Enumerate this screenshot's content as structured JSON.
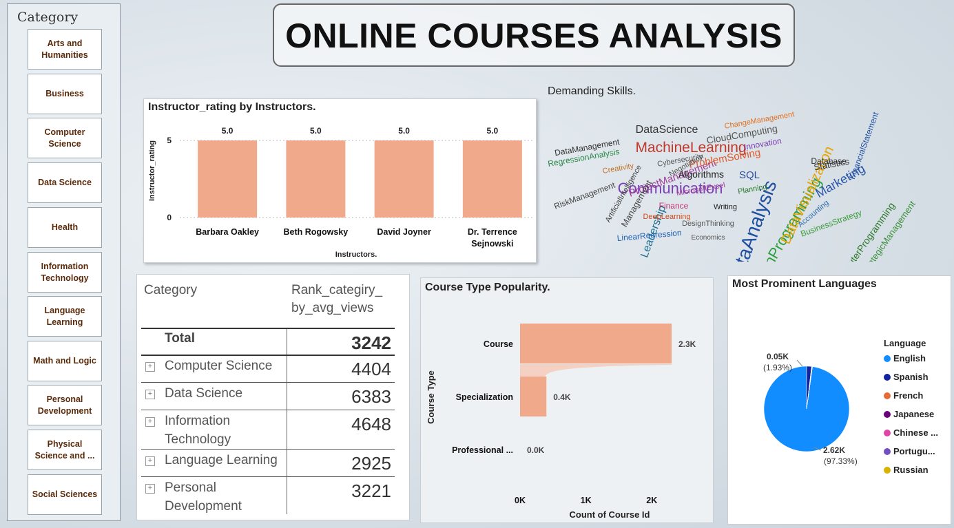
{
  "title": "ONLINE COURSES ANALYSIS",
  "slicer": {
    "title": "Category",
    "items": [
      "Arts and Humanities",
      "Business",
      "Computer Science",
      "Data Science",
      "Health",
      "Information Technology",
      "Language Learning",
      "Math and Logic",
      "Personal Development",
      "Physical Science and ...",
      "Social Sciences"
    ]
  },
  "instructor_chart": {
    "title": "Instructor_rating by Instructors.",
    "ylabel": "Instructor_rating",
    "xlabel": "Instructors.",
    "ticks": [
      "5",
      "0"
    ]
  },
  "wordcloud": {
    "title": "Demanding Skills.",
    "words": [
      {
        "text": "DataAnalysis",
        "color": "#1f4fa0"
      },
      {
        "text": "PythonProgramming",
        "color": "#2e9e3e"
      },
      {
        "text": "MachineLearning",
        "color": "#c0392b"
      },
      {
        "text": "Communication",
        "color": "#7b3fb5"
      },
      {
        "text": "DataScience",
        "color": "#333333"
      },
      {
        "text": "DataVisualization",
        "color": "#e6a300"
      },
      {
        "text": "Leadership",
        "color": "#1b6d8f"
      },
      {
        "text": "ProjectManagement",
        "color": "#a0409a"
      },
      {
        "text": "ProblemSolving",
        "color": "#e05a2a"
      },
      {
        "text": "Management",
        "color": "#444444"
      },
      {
        "text": "ComputerProgramming",
        "color": "#2a7a2a"
      },
      {
        "text": "Marketing",
        "color": "#2955a8"
      },
      {
        "text": "StrategicManagement",
        "color": "#3a8f3a"
      },
      {
        "text": "CloudComputing",
        "color": "#555555"
      },
      {
        "text": "Algorithms",
        "color": "#222222"
      },
      {
        "text": "SQL",
        "color": "#2a4f9a"
      },
      {
        "text": "RiskManagement",
        "color": "#444444"
      },
      {
        "text": "Finance",
        "color": "#c03070"
      },
      {
        "text": "DeepLearning",
        "color": "#d04a1a"
      },
      {
        "text": "RegressionAnalysis",
        "color": "#2a8a4a"
      },
      {
        "text": "DataManagement",
        "color": "#333333"
      },
      {
        "text": "LinearRegression",
        "color": "#1f5fb0"
      },
      {
        "text": "Innovation",
        "color": "#7a3fb0"
      },
      {
        "text": "Statistics",
        "color": "#333333"
      },
      {
        "text": "BusinessStrategy",
        "color": "#3a9a3a"
      },
      {
        "text": "Database",
        "color": "#333333"
      },
      {
        "text": "Cybersecurity",
        "color": "#555555"
      },
      {
        "text": "ChangeManagement",
        "color": "#e07020"
      },
      {
        "text": "Accounting",
        "color": "#2a6aa8"
      },
      {
        "text": "Writing",
        "color": "#222222"
      },
      {
        "text": "DesignThinking",
        "color": "#555555"
      },
      {
        "text": "Planning",
        "color": "#2a7a2a"
      },
      {
        "text": "Negotiation",
        "color": "#555555"
      },
      {
        "text": "Creativity",
        "color": "#c07020"
      },
      {
        "text": "MicrosoftExcel",
        "color": "#a0409a"
      },
      {
        "text": "ArtificialIntelligence",
        "color": "#444444"
      },
      {
        "text": "FinancialStatement",
        "color": "#1f4fa0"
      },
      {
        "text": "Economics",
        "color": "#555555"
      }
    ]
  },
  "table": {
    "header_category": "Category",
    "header_value": "Rank_categiry_by_avg_views",
    "header_value_lines": [
      "Rank_categiry_",
      "by_avg_views"
    ],
    "total_label": "Total",
    "total_value": "3242",
    "rows": [
      {
        "lines": [
          "Computer Science"
        ],
        "value": "4404"
      },
      {
        "lines": [
          "Data Science"
        ],
        "value": "6383"
      },
      {
        "lines": [
          "Information",
          "Technology"
        ],
        "value": "4648"
      },
      {
        "lines": [
          "Language Learning"
        ],
        "value": "2925"
      },
      {
        "lines": [
          "Personal",
          "Development"
        ],
        "value": "3221"
      }
    ]
  },
  "course_type": {
    "title": "Course Type Popularity.",
    "ylabel": "Course Type",
    "xlabel": "Count of Course Id",
    "ticks": [
      "0K",
      "1K",
      "2K"
    ]
  },
  "languages": {
    "title": "Most Prominent Languages",
    "legend_title": "Language",
    "legend": [
      "English",
      "Spanish",
      "French",
      "Japanese",
      "Chinese ...",
      "Portugu...",
      "Russian"
    ],
    "label_small": [
      "0.05K",
      "(1.93%)"
    ],
    "label_big": [
      "2.62K",
      "(97.33%)"
    ]
  },
  "chart_data": [
    {
      "type": "bar",
      "title": "Instructor_rating by Instructors.",
      "xlabel": "Instructors.",
      "ylabel": "Instructor_rating",
      "categories": [
        "Barbara Oakley",
        "Beth Rogowsky",
        "David Joyner",
        "Dr. Terrence Sejnowski"
      ],
      "values": [
        5.0,
        5.0,
        5.0,
        5.0
      ],
      "value_labels": [
        "5.0",
        "5.0",
        "5.0",
        "5.0"
      ],
      "ylim": [
        0,
        5
      ],
      "color": "#f0a98b",
      "grid": true
    },
    {
      "type": "bar",
      "orientation": "horizontal",
      "title": "Course Type Popularity.",
      "xlabel": "Count of Course Id",
      "ylabel": "Course Type",
      "categories": [
        "Course",
        "Specialization",
        "Professional ..."
      ],
      "values": [
        2.3,
        0.4,
        0.0
      ],
      "value_labels": [
        "2.3K",
        "0.4K",
        "0.0K"
      ],
      "xlim": [
        0,
        2.3
      ],
      "unit": "K",
      "color": "#f0a98b"
    },
    {
      "type": "pie",
      "title": "Most Prominent Languages",
      "legend_title": "Language",
      "categories": [
        "English",
        "Spanish",
        "French",
        "Japanese",
        "Chinese ...",
        "Portugu...",
        "Russian"
      ],
      "values": [
        2.62,
        0.05,
        0.003,
        0.002,
        0.002,
        0.001,
        0.001
      ],
      "percent": [
        97.33,
        1.93,
        0.2,
        0.15,
        0.15,
        0.12,
        0.12
      ],
      "colors": [
        "#118dff",
        "#12239e",
        "#e66c37",
        "#6b007b",
        "#e044a7",
        "#744ec2",
        "#d9b300"
      ],
      "legend_position": "right"
    }
  ]
}
